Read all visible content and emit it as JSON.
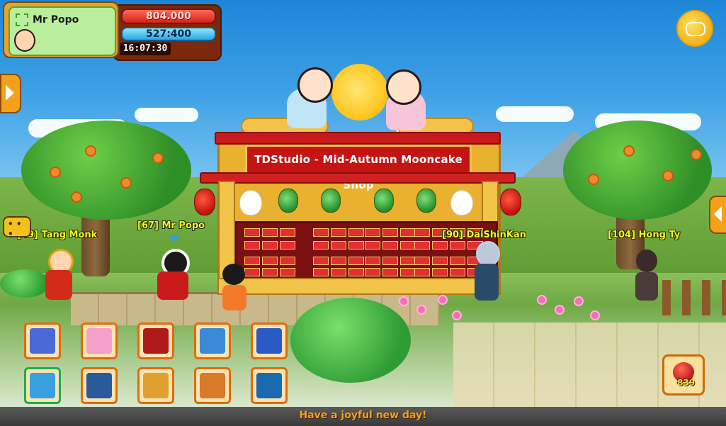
{
  "player": {
    "name": "Mr Popo",
    "hp": "804.000",
    "mp": "527:400",
    "clock": "16:07:30"
  },
  "shop": {
    "sign": "TDStudio - Mid-Autumn Mooncake Shop"
  },
  "characters": [
    {
      "label": "[49] Tang Monk"
    },
    {
      "label": "[67] Mr Popo"
    },
    {
      "label": "[90] DaiShinKan"
    },
    {
      "label": "[104] Hong Ty"
    }
  ],
  "skills": [
    {
      "name": "music-note-skill-icon",
      "color": "#4a6ad8"
    },
    {
      "name": "pink-burst-skill-icon",
      "color": "#f4a0c8"
    },
    {
      "name": "green-ring-skill-icon",
      "color": "#b01a1a"
    },
    {
      "name": "saiyan-blue-skill-icon",
      "color": "#3a8ad8"
    },
    {
      "name": "yellow-orbs-skill-icon",
      "color": "#2a5ac8"
    },
    {
      "name": "punch-skill-icon",
      "color": "#3aa0e0"
    },
    {
      "name": "shadow-dash-skill-icon",
      "color": "#2a5a9a"
    },
    {
      "name": "warrior-skill-icon",
      "color": "#e0a030"
    },
    {
      "name": "roar-skill-icon",
      "color": "#d87a2a"
    },
    {
      "name": "energy-wave-skill-icon",
      "color": "#1a6ab0"
    }
  ],
  "item": {
    "count": "839"
  },
  "marquee": {
    "text": "Have a joyful new day!"
  },
  "colors": {
    "sky": "#1e86d8",
    "shop_red": "#c41414",
    "shop_gold": "#e9b12f",
    "name_yellow": "#f7f02a",
    "accent_orange": "#f2a21a"
  }
}
